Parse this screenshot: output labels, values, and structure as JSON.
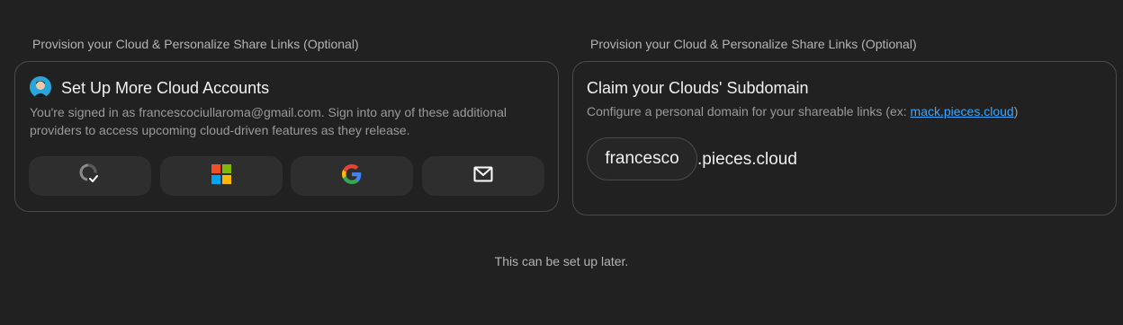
{
  "left_panel": {
    "section_label": "Provision your Cloud & Personalize Share Links (Optional)",
    "title": "Set Up More Cloud Accounts",
    "description": "You're signed in as francescociullaroma@gmail.com. Sign into any of these additional providers to access upcoming cloud-driven features as they release.",
    "providers": [
      {
        "name": "github",
        "icon": "github-icon",
        "status": "connected"
      },
      {
        "name": "microsoft",
        "icon": "microsoft-icon"
      },
      {
        "name": "google",
        "icon": "google-icon"
      },
      {
        "name": "email",
        "icon": "mail-icon"
      }
    ]
  },
  "right_panel": {
    "section_label": "Provision your Cloud & Personalize Share Links (Optional)",
    "title": "Claim your Clouds' Subdomain",
    "description_prefix": "Configure a personal domain for your shareable links (ex: ",
    "description_link": "mack.pieces.cloud",
    "description_suffix": ")",
    "subdomain_value": "francesco",
    "domain_suffix": ".pieces.cloud"
  },
  "footer": {
    "note": "This can be set up later."
  },
  "colors": {
    "background": "#212121",
    "card_border": "#4a4a4a",
    "button_bg": "#2e2e2e",
    "link": "#3ba7ff",
    "avatar_bg": "#29a6d9"
  }
}
